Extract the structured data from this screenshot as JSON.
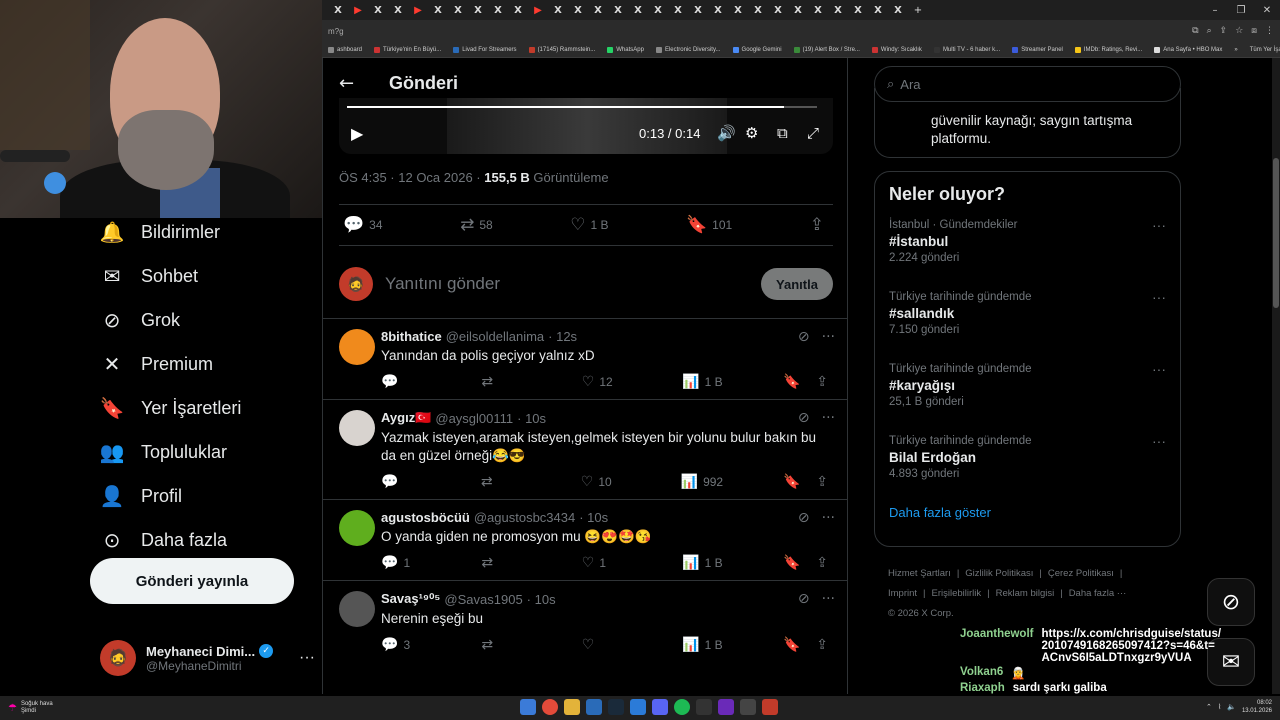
{
  "browser": {
    "url": "m?g",
    "bookmarks": [
      "ashboard",
      "Türkiye'nin En Büyü...",
      "Livad For Streamers",
      "(17145) Rammstein...",
      "WhatsApp",
      "Electronic Diversity...",
      "Google Gemini",
      "(19) Alert Box / Stre...",
      "Windy: Sıcaklık",
      "Multi TV - 6 haber k...",
      "Streamer Panel",
      "IMDb: Ratings, Revi...",
      "Ana Sayfa • HBO Max"
    ],
    "bookmarks_more": "»",
    "bookmarks_folder": "Tüm Yer İşaretleri",
    "tab_glyph": "X"
  },
  "nav": {
    "items": [
      {
        "label": "Bildirimler",
        "icon": "bell-icon",
        "glyph": "🔔"
      },
      {
        "label": "Sohbet",
        "icon": "mail-icon",
        "glyph": "✉"
      },
      {
        "label": "Grok",
        "icon": "grok-icon",
        "glyph": "⊘"
      },
      {
        "label": "Premium",
        "icon": "x-logo-icon",
        "glyph": "✕"
      },
      {
        "label": "Yer İşaretleri",
        "icon": "bookmark-icon",
        "glyph": "🔖"
      },
      {
        "label": "Topluluklar",
        "icon": "communities-icon",
        "glyph": "👥"
      },
      {
        "label": "Profil",
        "icon": "person-icon",
        "glyph": "👤"
      },
      {
        "label": "Daha fazla",
        "icon": "more-circle-icon",
        "glyph": "⊙"
      }
    ],
    "post_button": "Gönderi yayınla"
  },
  "profile": {
    "name": "Meyhaneci Dimi...",
    "handle": "@MeyhaneDimitri",
    "more": "···"
  },
  "post": {
    "header_title": "Gönderi",
    "video": {
      "time": "0:13 / 0:14",
      "progress": 0.93
    },
    "meta_time": "ÖS 4:35 · 12 Oca 2026 · ",
    "views": "155,5 B",
    "views_label": " Görüntüleme",
    "replies": "34",
    "reposts": "58",
    "likes": "1 B",
    "bookmarks": "101",
    "reply_placeholder": "Yanıtını gönder",
    "reply_button": "Yanıtla"
  },
  "tweets": [
    {
      "name": "8bithatice",
      "handle": "@eilsoldellanima",
      "time": "· 12s",
      "text": "Yanından da polis geçiyor yalnız xD",
      "replies": "",
      "reposts": "",
      "likes": "12",
      "views": "1 B",
      "avatar_color": "#f08a1c"
    },
    {
      "name": "Aygız🇹🇷",
      "handle": "@aysgl00111",
      "time": "· 10s",
      "text": "Yazmak isteyen,aramak isteyen,gelmek isteyen bir yolunu bulur bakın bu da en güzel örneği😂😎",
      "replies": "",
      "reposts": "",
      "likes": "10",
      "views": "992",
      "avatar_color": "#d8d3cf"
    },
    {
      "name": "agustosböcüü",
      "handle": "@agustosbc3434",
      "time": "· 10s",
      "text": "O yanda giden ne promosyon mu 😆😍🤩😘",
      "replies": "1",
      "reposts": "",
      "likes": "1",
      "views": "1 B",
      "avatar_color": "#5fae1e"
    },
    {
      "name": "Savaş¹⁹⁰⁵",
      "handle": "@Savas1905",
      "time": "· 10s",
      "text": "Nerenin eşeği bu",
      "replies": "3",
      "reposts": "",
      "likes": "",
      "views": "1 B",
      "avatar_color": "#555555"
    }
  ],
  "right": {
    "search_placeholder": "Ara",
    "card_text": "güvenilir kaynağı; saygın tartışma platformu.",
    "trends_title": "Neler oluyor?",
    "trends": [
      {
        "context": "İstanbul · Gündemdekiler",
        "topic": "#İstanbul",
        "count": "2.224 gönderi"
      },
      {
        "context": "Türkiye tarihinde gündemde",
        "topic": "#sallandık",
        "count": "7.150 gönderi"
      },
      {
        "context": "Türkiye tarihinde gündemde",
        "topic": "#karyağışı",
        "count": "25,1 B gönderi"
      },
      {
        "context": "Türkiye tarihinde gündemde",
        "topic": "Bilal Erdoğan",
        "count": "4.893 gönderi"
      }
    ],
    "show_more": "Daha fazla göster",
    "footer_line1": [
      "Hizmet Şartları",
      "|",
      "Gizlilik Politikası",
      "|",
      "Çerez Politikası",
      "|"
    ],
    "footer_line2": [
      "Imprint",
      "|",
      "Erişilebilirlik",
      "|",
      "Reklam bilgisi",
      "|",
      "Daha fazla ···"
    ],
    "copyright": "© 2026 X Corp."
  },
  "chat": [
    {
      "user": "Joaanthewolf",
      "message": "https://x.com/chrisdguise/status/2010749168265097412?s=46&t=ACnvS6I5aLDTnxgzr9yVUA"
    },
    {
      "user": "Volkan6",
      "message": "🧝"
    },
    {
      "user": "Riaxaph",
      "message": "sardı şarkı galiba"
    }
  ],
  "taskbar": {
    "weather_title": "Soğuk hava",
    "weather_sub": "Şimdi",
    "time": "08:02",
    "date": "13.01.2026"
  }
}
